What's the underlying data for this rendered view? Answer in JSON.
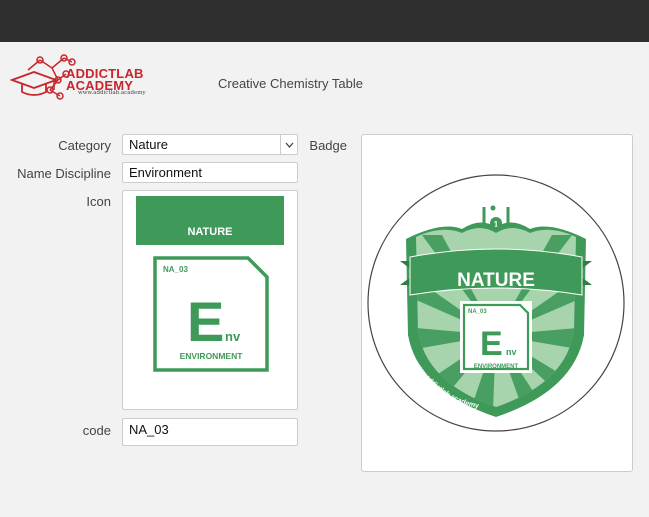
{
  "brand": {
    "name_line1": "ADDICTLAB",
    "name_line2": "ACADEMY",
    "url": "www.addictlab.academy"
  },
  "app_title": "Creative Chemistry Table",
  "form": {
    "category": {
      "label": "Category",
      "value": "Nature"
    },
    "name_discipline": {
      "label": "Name Discipline",
      "value": "Environment"
    },
    "icon": {
      "label": "Icon"
    },
    "code": {
      "label": "code",
      "value": "NA_03"
    },
    "badge": {
      "label": "Badge"
    }
  },
  "icon_preview": {
    "banner_text": "NATURE",
    "element_code": "NA_03",
    "symbol_main": "E",
    "symbol_sub": "nv",
    "element_name": "ENVIRONMENT"
  },
  "badge_preview": {
    "banner_text": "NATURE",
    "element_code": "NA_03",
    "symbol_main": "E",
    "symbol_sub": "nv",
    "element_name": "ENVIRONMENT",
    "curved_url": "www.addictlab.academy",
    "flask_number": "1"
  },
  "colors": {
    "topbar": "#2f2f2f",
    "brand_red": "#c8262c",
    "nature_green": "#3f9a59",
    "light_green": "#a7d3ad"
  },
  "icons": [
    "molecule-logo-icon",
    "chevron-down-icon",
    "flask-icon"
  ]
}
